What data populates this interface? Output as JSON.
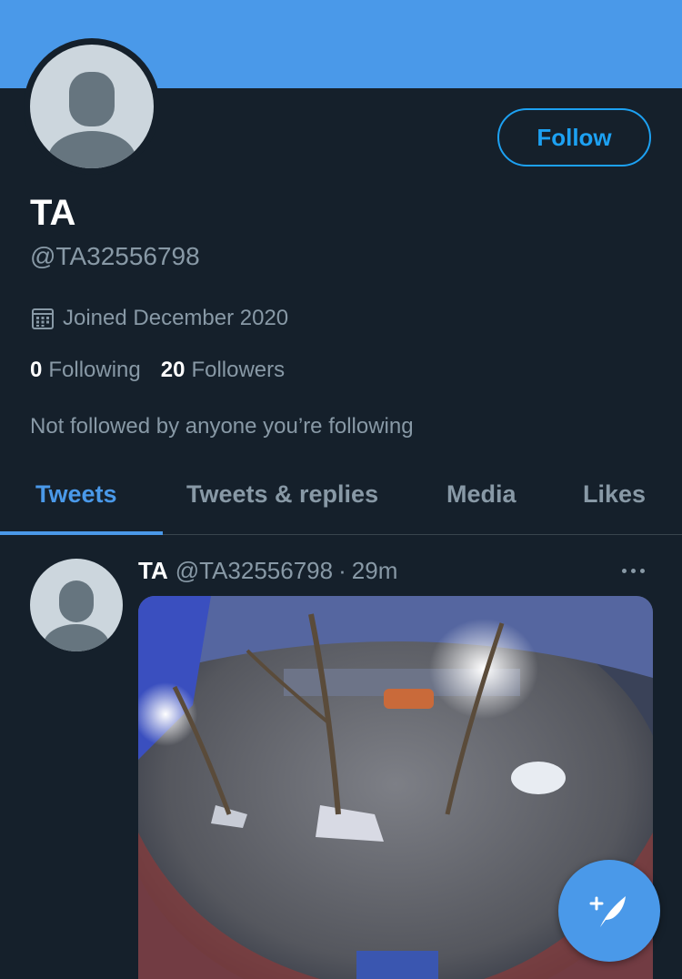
{
  "colors": {
    "background": "#15202b",
    "banner": "#4a99e9",
    "accent": "#1da1f2",
    "muted_text": "#8899a6",
    "divider": "#38444d"
  },
  "profile": {
    "name": "TA",
    "handle": "@TA32556798",
    "joined": "Joined December 2020",
    "following_count": "0",
    "following_label": "Following",
    "followers_count": "20",
    "followers_label": "Followers",
    "not_followed_text": "Not followed by anyone you’re following"
  },
  "follow_button": {
    "label": "Follow"
  },
  "tabs": [
    {
      "label": "Tweets",
      "active": true
    },
    {
      "label": "Tweets & replies",
      "active": false
    },
    {
      "label": "Media",
      "active": false
    },
    {
      "label": "Likes",
      "active": false
    }
  ],
  "tweet": {
    "name": "TA",
    "handle": "@TA32556798",
    "separator": "·",
    "time": "29m",
    "media_icon": "fisheye-street-photo"
  },
  "icons": {
    "calendar": "calendar-icon",
    "more": "more-icon",
    "compose": "compose-tweet-icon"
  }
}
